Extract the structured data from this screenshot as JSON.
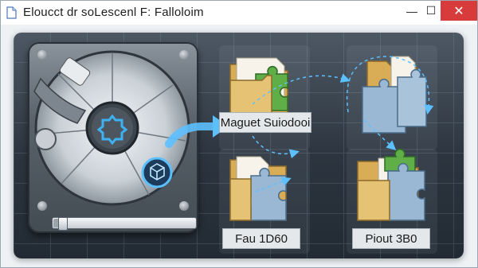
{
  "window": {
    "title": "Eloucct dr soLescenl F:  Falloloim",
    "controls": {
      "minimize": "—",
      "maximize": "☐",
      "close": "✕"
    }
  },
  "drive": {
    "progress_percent": 5
  },
  "tiles": {
    "top_left_label": "Maguet Suiodooi",
    "top_right_label": "",
    "bottom_left_label": "Fau 1D60",
    "bottom_right_label": "Piout 3B0"
  },
  "colors": {
    "accent": "#38a3e6",
    "folder": "#e6c274",
    "puzzle_green": "#5fae48",
    "puzzle_blue": "#9ab8d3",
    "close_red": "#d83b3b"
  }
}
